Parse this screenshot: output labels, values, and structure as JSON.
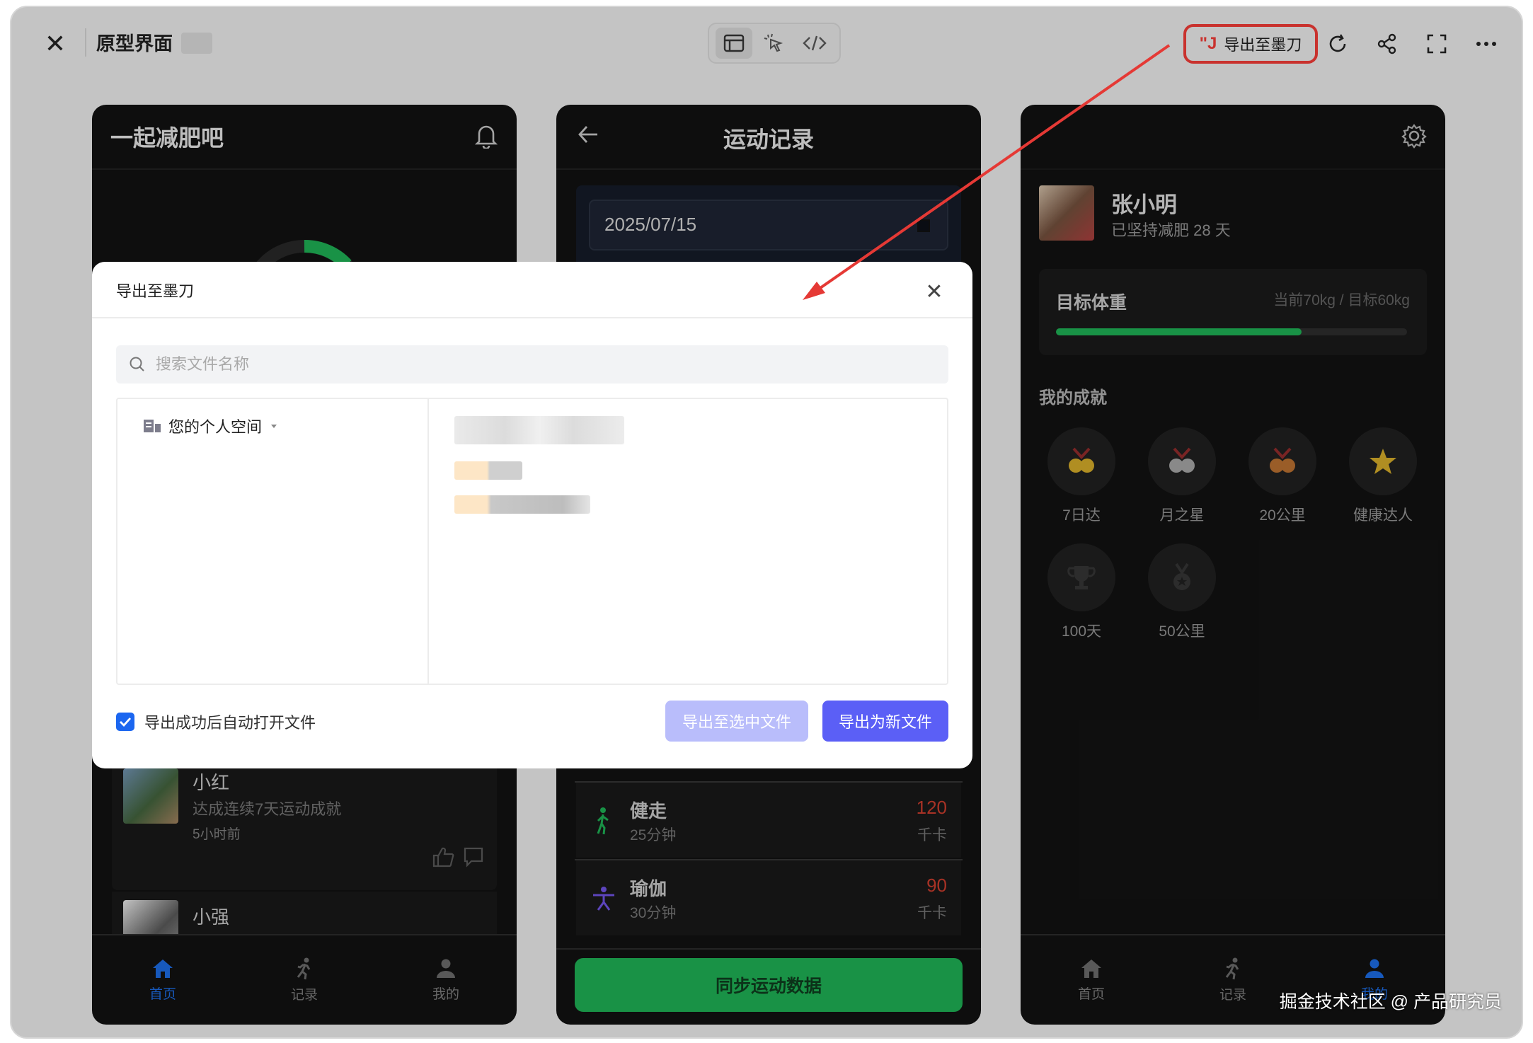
{
  "topbar": {
    "title": "原型界面",
    "export_label": "导出至墨刀",
    "export_logo": "\"J",
    "icons": [
      "close-icon",
      "window-icon",
      "pointer-icon",
      "code-icon",
      "refresh-icon",
      "share-icon",
      "fullscreen-icon",
      "more-icon"
    ]
  },
  "home": {
    "title": "一起减肥吧",
    "feed": [
      {
        "name": "小红",
        "text": "达成连续7天运动成就",
        "time": "5小时前"
      },
      {
        "name": "小强"
      }
    ],
    "tabs": [
      "首页",
      "记录",
      "我的"
    ]
  },
  "records": {
    "title": "运动记录",
    "date": "2025/07/15",
    "items": [
      {
        "name": "健走",
        "duration": "25分钟",
        "calories": "120",
        "unit": "千卡"
      },
      {
        "name": "瑜伽",
        "duration": "30分钟",
        "calories": "90",
        "unit": "千卡"
      }
    ],
    "sync_label": "同步运动数据"
  },
  "profile": {
    "name": "张小明",
    "subtitle": "已坚持减肥 28 天",
    "goal_label": "目标体重",
    "goal_info": "当前70kg / 目标60kg",
    "goal_progress": 0.7,
    "achievements_title": "我的成就",
    "badges": [
      "7日达",
      "月之星",
      "20公里",
      "健康达人",
      "100天",
      "50公里"
    ],
    "tabs": [
      "首页",
      "记录",
      "我的"
    ]
  },
  "modal": {
    "title": "导出至墨刀",
    "search_placeholder": "搜索文件名称",
    "space_label": "您的个人空间",
    "auto_open_label": "导出成功后自动打开文件",
    "auto_open_checked": true,
    "btn_export_selected": "导出至选中文件",
    "btn_export_new": "导出为新文件"
  },
  "colors": {
    "accent_red": "#e53935",
    "primary_purple": "#5b5ff6",
    "disabled_purple": "#b9bdfb",
    "green": "#1da750",
    "tab_blue": "#1b66d6"
  },
  "watermark": "掘金技术社区 @ 产品研究员"
}
